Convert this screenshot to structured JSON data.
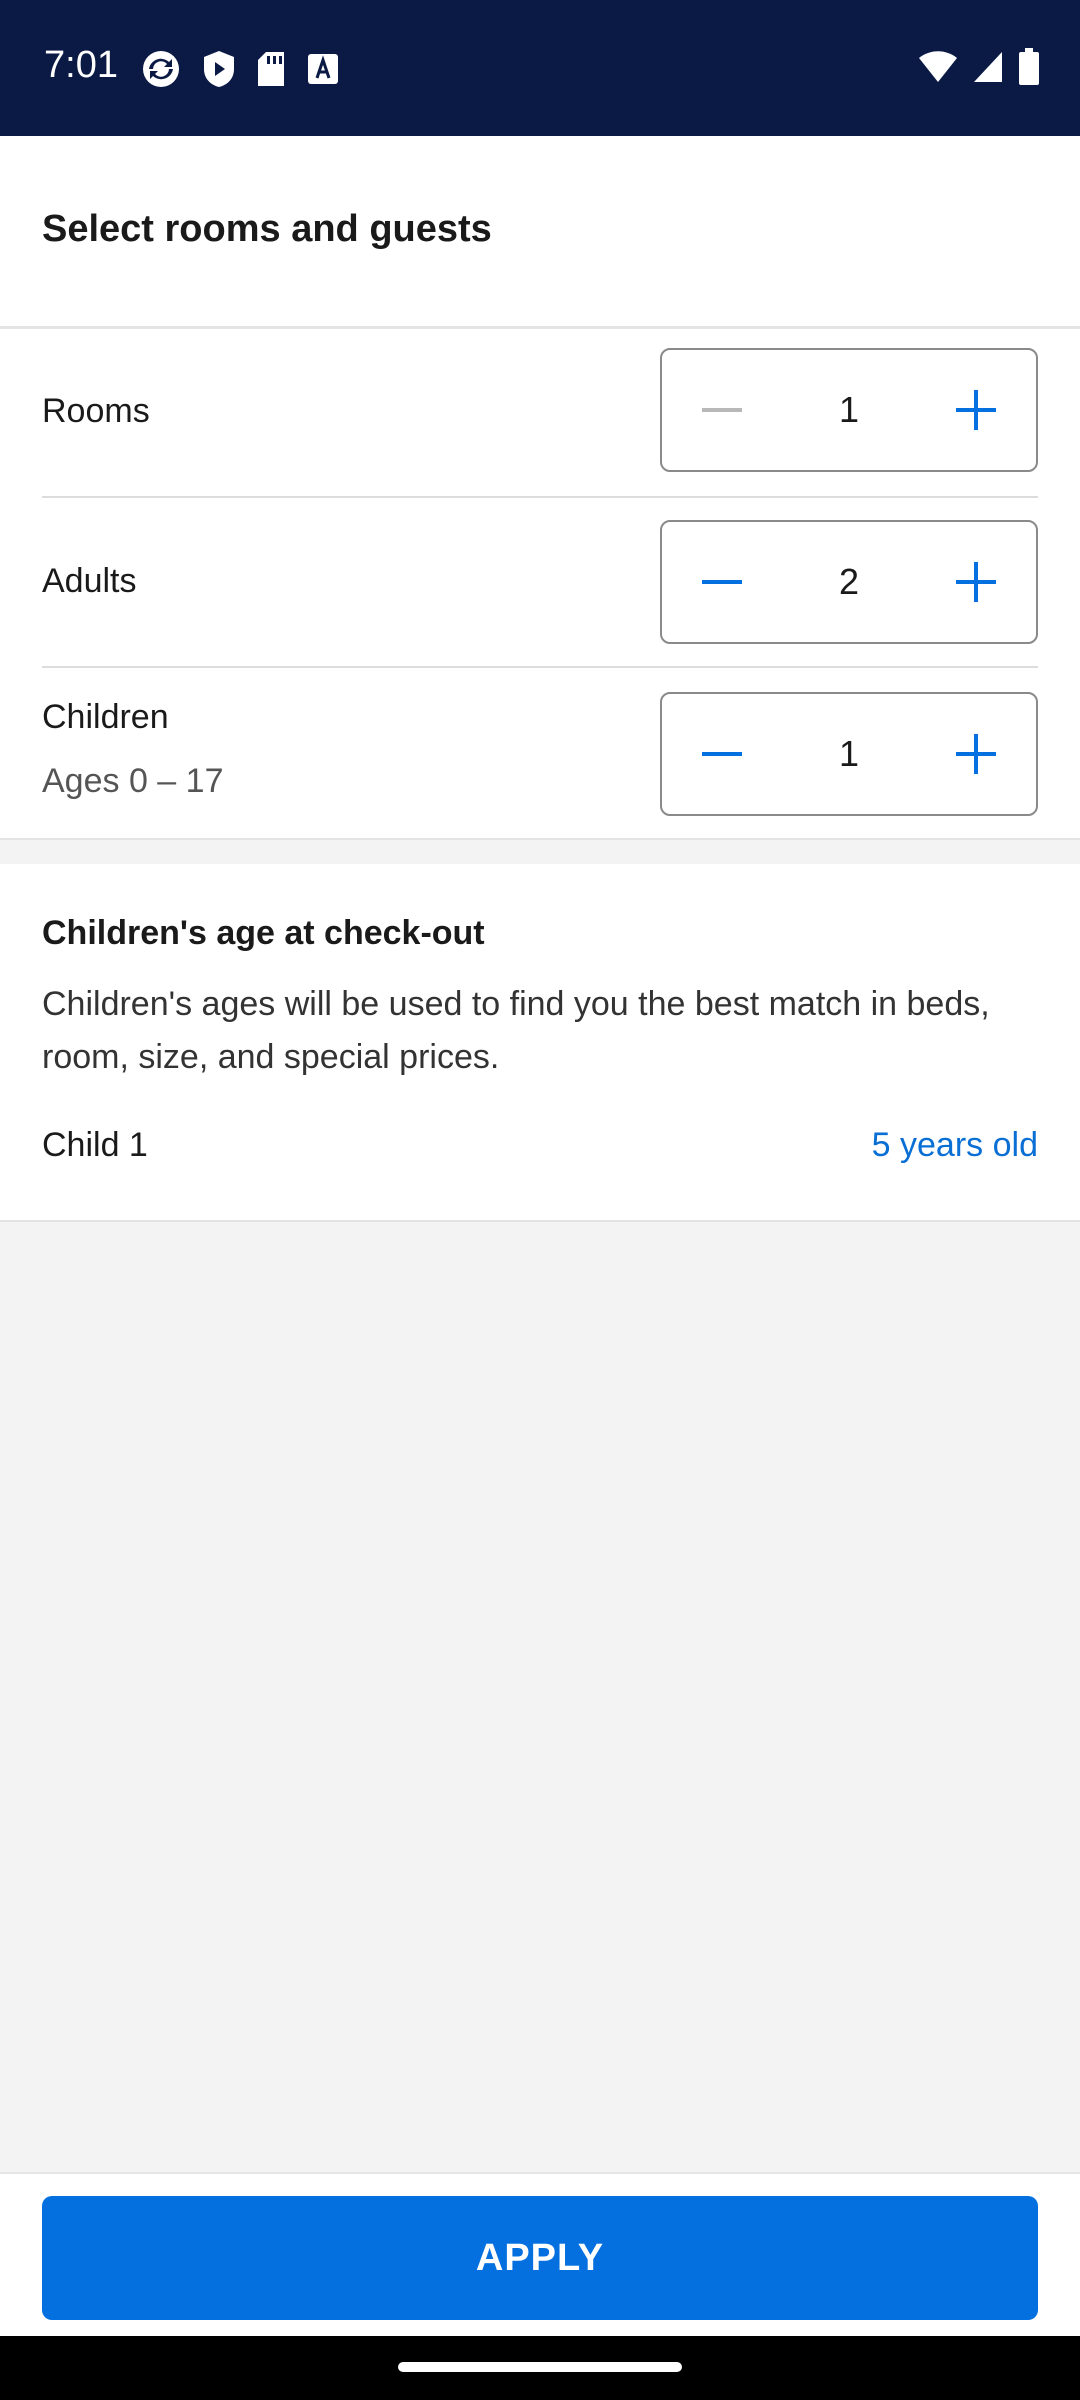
{
  "status_bar": {
    "time": "7:01",
    "left_icons": [
      "sync-icon",
      "shield-play-icon",
      "sd-card-icon",
      "font-icon"
    ],
    "right_icons": [
      "wifi-icon",
      "signal-icon",
      "battery-icon"
    ]
  },
  "sheet": {
    "title": "Select rooms and guests"
  },
  "rows": {
    "rooms": {
      "label": "Rooms",
      "value": "1",
      "minus_enabled": false
    },
    "adults": {
      "label": "Adults",
      "value": "2",
      "minus_enabled": true
    },
    "children": {
      "label": "Children",
      "sub": "Ages 0 – 17",
      "value": "1",
      "minus_enabled": true
    }
  },
  "children_section": {
    "title": "Children's age at check-out",
    "description": "Children's ages will be used to find you the best match in beds, room, size, and special prices.",
    "children": [
      {
        "label": "Child 1",
        "age": "5 years old"
      }
    ]
  },
  "apply_button": {
    "label": "APPLY"
  },
  "colors": {
    "accent": "#0470e0",
    "link": "#0a6fd4",
    "status_bar_bg": "#0b1a45",
    "disabled_icon": "#b8b8b8"
  }
}
